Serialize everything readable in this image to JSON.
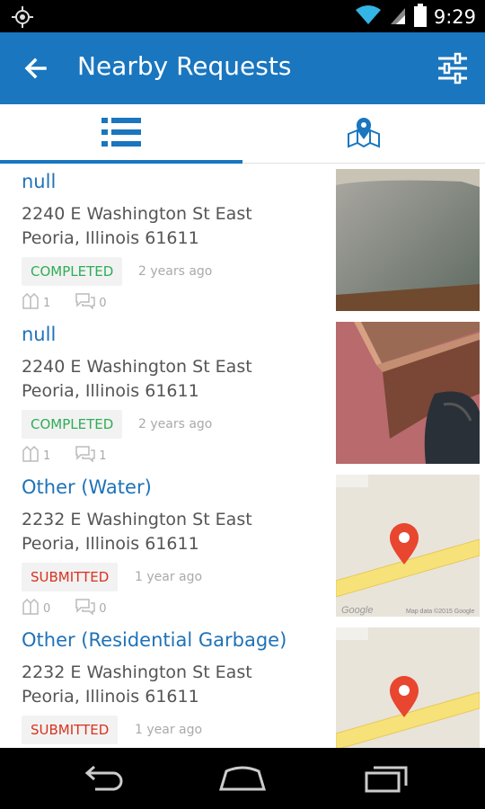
{
  "status_bar": {
    "time": "9:29"
  },
  "app_bar": {
    "title": "Nearby Requests"
  },
  "tabs": [
    {
      "name": "list",
      "icon": "list-icon",
      "active": true
    },
    {
      "name": "map",
      "icon": "map-pin-icon",
      "active": false
    }
  ],
  "colors": {
    "accent": "#1976bf",
    "completed": "#2ead56",
    "submitted": "#d8321f",
    "title_link": "#1f72b8"
  },
  "requests": [
    {
      "title": "null",
      "address_line1": "2240  E Washington St East",
      "address_line2": "Peoria, Illinois 61611",
      "status": "COMPLETED",
      "time": "2 years ago",
      "votes": "1",
      "comments": "0",
      "thumbnail": "photo-fabric"
    },
    {
      "title": "null",
      "address_line1": "2240  E Washington St East",
      "address_line2": "Peoria, Illinois 61611",
      "status": "COMPLETED",
      "time": "2 years ago",
      "votes": "1",
      "comments": "1",
      "thumbnail": "photo-furniture"
    },
    {
      "title": "Other (Water)",
      "address_line1": "2232  E Washington St East",
      "address_line2": "Peoria, Illinois 61611",
      "status": "SUBMITTED",
      "time": "1 year ago",
      "votes": "0",
      "comments": "0",
      "thumbnail": "map",
      "map_logo": "Google",
      "map_credit": "Map data ©2015 Google"
    },
    {
      "title": "Other (Residential Garbage)",
      "address_line1": "2232  E Washington St East",
      "address_line2": "Peoria, Illinois 61611",
      "status": "SUBMITTED",
      "time": "1 year ago",
      "thumbnail": "map"
    }
  ]
}
